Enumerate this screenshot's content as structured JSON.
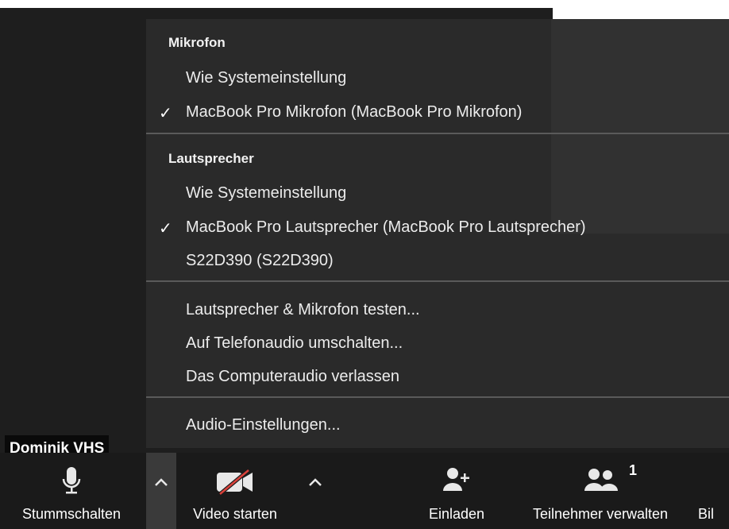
{
  "participant": {
    "name": "Dominik VHS"
  },
  "audio_menu": {
    "microphone_header": "Mikrofon",
    "microphone_items": [
      {
        "label": "Wie Systemeinstellung",
        "checked": false
      },
      {
        "label": "MacBook Pro Mikrofon (MacBook Pro Mikrofon)",
        "checked": true
      }
    ],
    "speaker_header": "Lautsprecher",
    "speaker_items": [
      {
        "label": "Wie Systemeinstellung",
        "checked": false
      },
      {
        "label": "MacBook Pro Lautsprecher (MacBook Pro Lautsprecher)",
        "checked": true
      },
      {
        "label": "S22D390 (S22D390)",
        "checked": false
      }
    ],
    "check_glyph": "✓",
    "actions": [
      "Lautsprecher & Mikrofon testen...",
      "Auf Telefonaudio umschalten...",
      "Das Computeraudio verlassen"
    ],
    "settings": "Audio-Einstellungen..."
  },
  "toolbar": {
    "mute_label": "Stummschalten",
    "video_label": "Video starten",
    "invite_label": "Einladen",
    "participants_label": "Teilnehmer verwalten",
    "participants_count": "1",
    "share_label_partial": "Bil",
    "caret_glyph": "^"
  },
  "colors": {
    "toolbar_bg": "#1a1a1a",
    "menu_bg": "#2a2a2a",
    "video_off_slash": "#d9413a"
  }
}
